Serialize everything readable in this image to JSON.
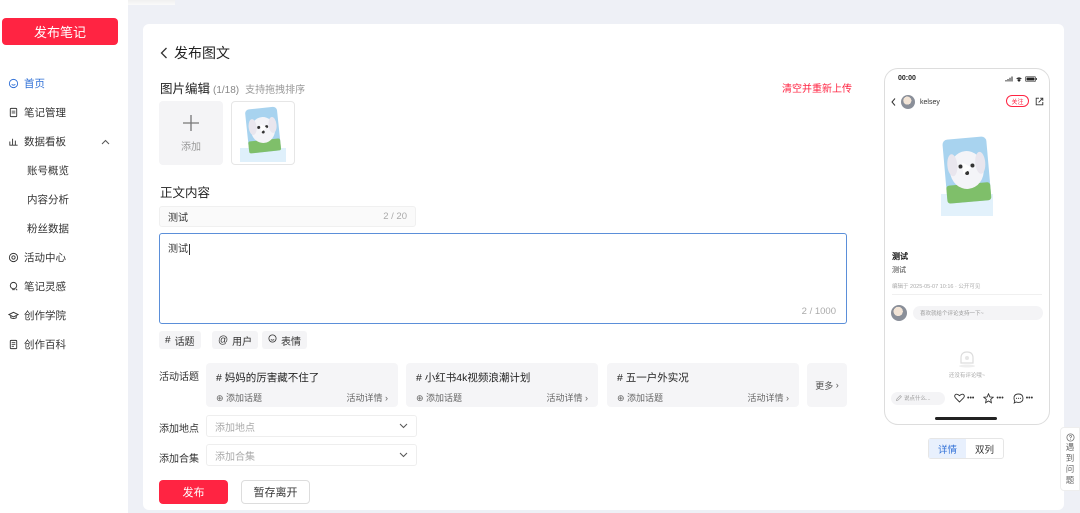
{
  "sidebar": {
    "publish_note": "发布笔记",
    "items": [
      {
        "label": "首页"
      },
      {
        "label": "笔记管理"
      },
      {
        "label": "数据看板"
      },
      {
        "label": "账号概览"
      },
      {
        "label": "内容分析"
      },
      {
        "label": "粉丝数据"
      },
      {
        "label": "活动中心"
      },
      {
        "label": "笔记灵感"
      },
      {
        "label": "创作学院"
      },
      {
        "label": "创作百科"
      }
    ]
  },
  "header": {
    "title": "发布图文"
  },
  "image_edit": {
    "title": "图片编辑",
    "count": "(1/18)",
    "hint": "支持拖拽排序",
    "clear": "清空并重新上传",
    "add_label": "添加"
  },
  "content": {
    "section_title": "正文内容",
    "title_value": "测试",
    "title_count": "2 / 20",
    "body_value": "测试",
    "body_count": "2 / 1000"
  },
  "chips": {
    "topic": "话题",
    "user": "用户",
    "emoji": "表情"
  },
  "activity": {
    "label": "活动话题",
    "topics": [
      {
        "name": "妈妈的厉害藏不住了",
        "add": "添加话题",
        "detail": "活动详情"
      },
      {
        "name": "小红书4k视频浪潮计划",
        "add": "添加话题",
        "detail": "活动详情"
      },
      {
        "name": "五一户外实况",
        "add": "添加话题",
        "detail": "活动详情"
      }
    ],
    "more": "更多"
  },
  "location": {
    "label": "添加地点",
    "placeholder": "添加地点"
  },
  "collection": {
    "label": "添加合集",
    "placeholder": "添加合集"
  },
  "actions": {
    "publish": "发布",
    "draft": "暂存离开"
  },
  "preview": {
    "time": "00:00",
    "username": "kelsey",
    "follow": "关注",
    "title": "测试",
    "body": "测试",
    "meta": "编辑于 2025-05-07 10:16 · 公开可见",
    "comment_placeholder": "喜欢就给个评论支持一下~",
    "empty_text": "还没有评论哦~",
    "say_placeholder": "说点什么...",
    "like": "•••",
    "collect": "•••",
    "comment": "•••",
    "tabs": [
      "详情",
      "双列"
    ]
  },
  "feedback": [
    "遇",
    "到",
    "问",
    "题"
  ],
  "colors": {
    "brand": "#ff2442",
    "accent": "#2f6fd6"
  }
}
